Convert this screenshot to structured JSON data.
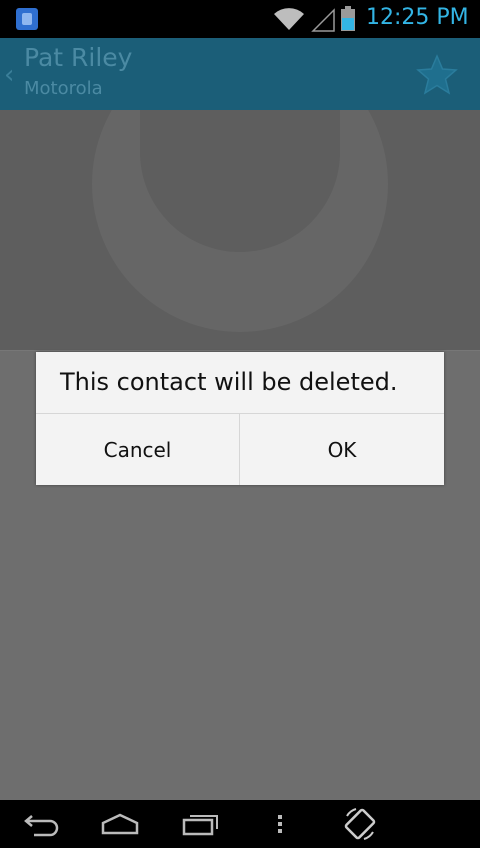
{
  "status_bar": {
    "time": "12:25 PM",
    "icons": [
      "app-notification-icon",
      "wifi-icon",
      "signal-icon",
      "battery-icon"
    ],
    "accent_color": "#33b5e5"
  },
  "action_bar": {
    "contact_name": "Pat Riley",
    "company": "Motorola",
    "icons": [
      "back-chevron-icon",
      "star-icon"
    ]
  },
  "dialog": {
    "message": "This contact will be deleted.",
    "cancel_label": "Cancel",
    "ok_label": "OK"
  },
  "nav_bar": {
    "icons": [
      "back-icon",
      "home-icon",
      "recent-apps-icon",
      "menu-icon",
      "rotate-icon"
    ]
  }
}
